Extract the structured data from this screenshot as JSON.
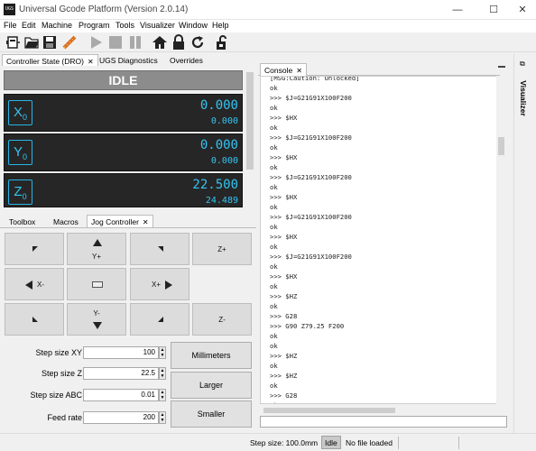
{
  "window": {
    "logo_text": "UGS",
    "title": "Universal Gcode Platform (Version 2.0.14)",
    "minimize": "—",
    "maximize": "☐",
    "close": "✕"
  },
  "menu": [
    "File",
    "Edit",
    "Machine",
    "Program",
    "Tools",
    "Visualizer",
    "Window",
    "Help"
  ],
  "toolbar_icons": [
    "connect-icon",
    "open-folder-icon",
    "save-icon",
    "probe-wand-icon",
    "play-icon",
    "stop-icon",
    "pause-icon",
    "home-icon",
    "lock-icon",
    "reset-icon",
    "unlock-icon"
  ],
  "top_tabs": [
    {
      "label": "Controller State (DRO)",
      "closable": true,
      "active": true
    },
    {
      "label": "UGS Diagnostics",
      "closable": false,
      "active": false
    },
    {
      "label": "Overrides",
      "closable": false,
      "active": false
    }
  ],
  "console_tab": {
    "label": "Console"
  },
  "visualizer_tab": {
    "label": "Visualizer"
  },
  "dro": {
    "state": "IDLE",
    "axes": [
      {
        "letter": "X",
        "sub": "0",
        "work": "0.000",
        "machine": "0.000"
      },
      {
        "letter": "Y",
        "sub": "0",
        "work": "0.000",
        "machine": "0.000"
      },
      {
        "letter": "Z",
        "sub": "0",
        "work": "22.500",
        "machine": "24.489"
      }
    ]
  },
  "bottom_tabs": [
    {
      "label": "Toolbox"
    },
    {
      "label": "Macros"
    },
    {
      "label": "Jog Controller"
    }
  ],
  "jog": {
    "buttons": [
      "",
      "Y+",
      "",
      "Z+",
      "X-",
      "",
      "X+",
      "",
      "",
      "Y-",
      "",
      "Z-"
    ],
    "fields": [
      {
        "label": "Step size XY",
        "value": "100"
      },
      {
        "label": "Step size Z",
        "value": "22.5"
      },
      {
        "label": "Step size ABC",
        "value": "0.01"
      },
      {
        "label": "Feed rate",
        "value": "200"
      }
    ],
    "side_buttons": [
      "Millimeters",
      "Larger",
      "Smaller"
    ]
  },
  "console": {
    "lines": [
      "[MSG:Caution: Unlocked]",
      "ok",
      ">>> $J=G21G91X100F200",
      "ok",
      ">>> $HX",
      "ok",
      ">>> $J=G21G91X100F200",
      "ok",
      ">>> $HX",
      "ok",
      ">>> $J=G21G91X100F200",
      "ok",
      ">>> $HX",
      "ok",
      ">>> $J=G21G91X100F200",
      "ok",
      ">>> $HX",
      "ok",
      ">>> $J=G21G91X100F200",
      "ok",
      ">>> $HX",
      "ok",
      ">>> $HZ",
      "ok",
      ">>> G28",
      ">>> G90 Z79.25 F200",
      "ok",
      "ok",
      ">>> $HZ",
      "ok",
      ">>> $HZ",
      "ok",
      ">>> G28",
      "ok"
    ]
  },
  "status": {
    "step_size": "Step size: 100.0mm",
    "state": "Idle",
    "file": "No file loaded"
  },
  "colors": {
    "dro_text": "#35c4f2",
    "dro_bg": "#262626",
    "state_bg": "#8c8c8c"
  }
}
